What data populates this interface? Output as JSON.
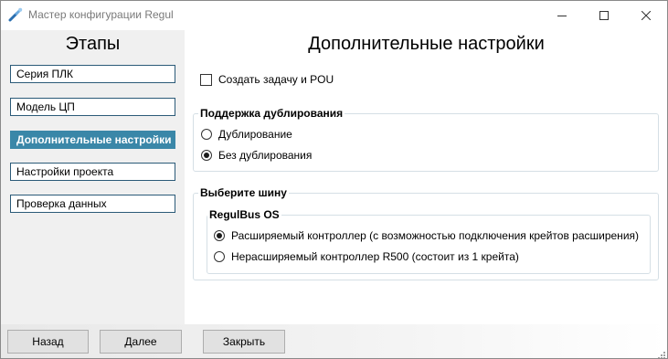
{
  "window": {
    "title": "Мастер конфигурации Regul"
  },
  "left_panel": {
    "title": "Этапы",
    "items": [
      {
        "label": "Серия ПЛК",
        "active": false
      },
      {
        "label": "Модель ЦП",
        "active": false
      },
      {
        "label": "Дополнительные настройки",
        "active": true
      },
      {
        "label": "Настройки проекта",
        "active": false
      },
      {
        "label": "Проверка данных",
        "active": false
      }
    ]
  },
  "main": {
    "title": "Дополнительные настройки",
    "create_task_checkbox": {
      "label": "Создать задачу и POU",
      "checked": false
    },
    "redundancy_group": {
      "title": "Поддержка дублирования",
      "options": [
        {
          "label": "Дублирование",
          "checked": false
        },
        {
          "label": "Без дублирования",
          "checked": true
        }
      ]
    },
    "bus_group": {
      "title": "Выберите шину",
      "regulbus_group": {
        "title": "RegulBus OS",
        "options": [
          {
            "label": "Расширяемый контроллер (с возможностью подключения крейтов расширения)",
            "checked": true
          },
          {
            "label": "Нерасширяемый контроллер R500 (состоит из 1 крейта)",
            "checked": false
          }
        ]
      }
    }
  },
  "buttons": {
    "back": "Назад",
    "next": "Далее",
    "close": "Закрыть"
  },
  "colors": {
    "active_item_bg": "#3a87a8",
    "item_border": "#2b5a78",
    "left_panel_bg": "#f0f0f0",
    "group_border": "#d5dfe5"
  },
  "icons": {
    "app": "wrench-icon",
    "minimize": "minimize-icon",
    "maximize": "maximize-icon",
    "close": "close-icon"
  }
}
